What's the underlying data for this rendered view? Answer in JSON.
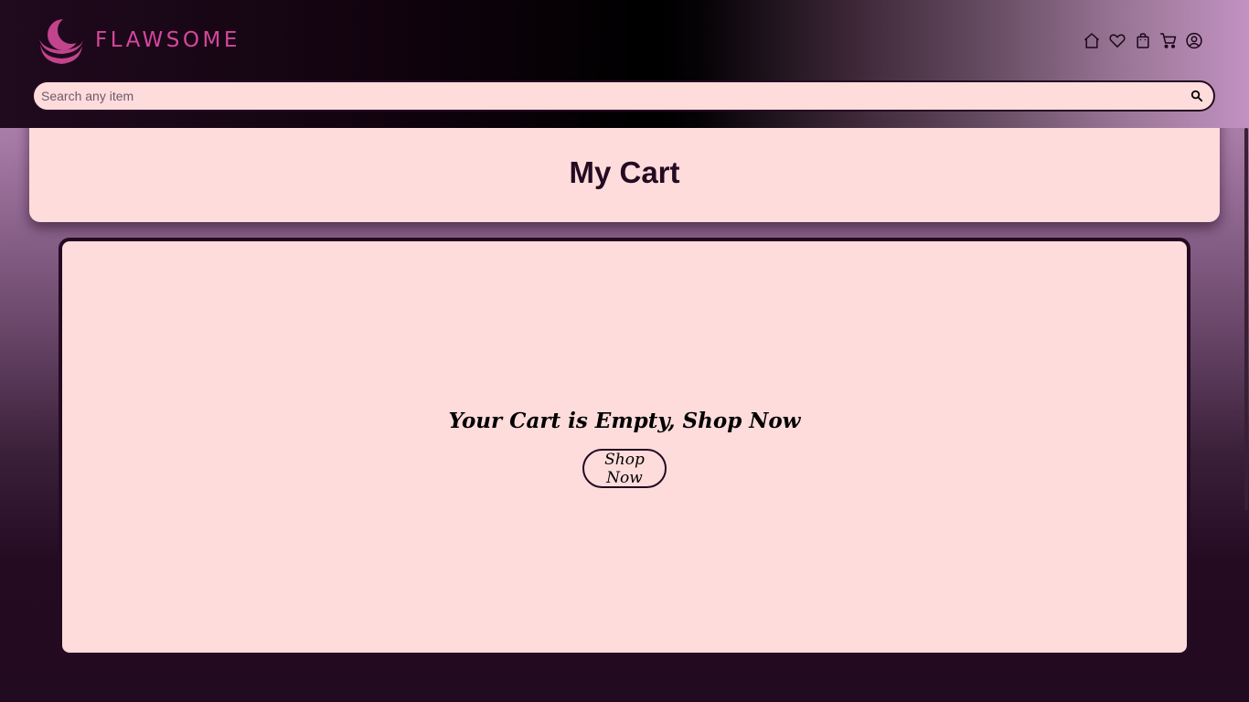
{
  "brand": {
    "name": "FLAWSOME",
    "color": "#d5479d"
  },
  "nav": [
    {
      "icon": "home-icon",
      "label": "Home"
    },
    {
      "icon": "heart-icon",
      "label": "Wishlist"
    },
    {
      "icon": "shopping-bag-icon",
      "label": "Orders"
    },
    {
      "icon": "cart-icon",
      "label": "Cart"
    },
    {
      "icon": "user-icon",
      "label": "Account"
    }
  ],
  "search": {
    "placeholder": "Search any item",
    "value": "",
    "icon": "search-icon"
  },
  "page": {
    "title": "My Cart"
  },
  "cart": {
    "empty_message": "Your Cart is Empty, Shop Now",
    "shop_button": "Shop Now"
  },
  "colors": {
    "card_background": "#ffdcdc",
    "dark": "#240b22"
  }
}
